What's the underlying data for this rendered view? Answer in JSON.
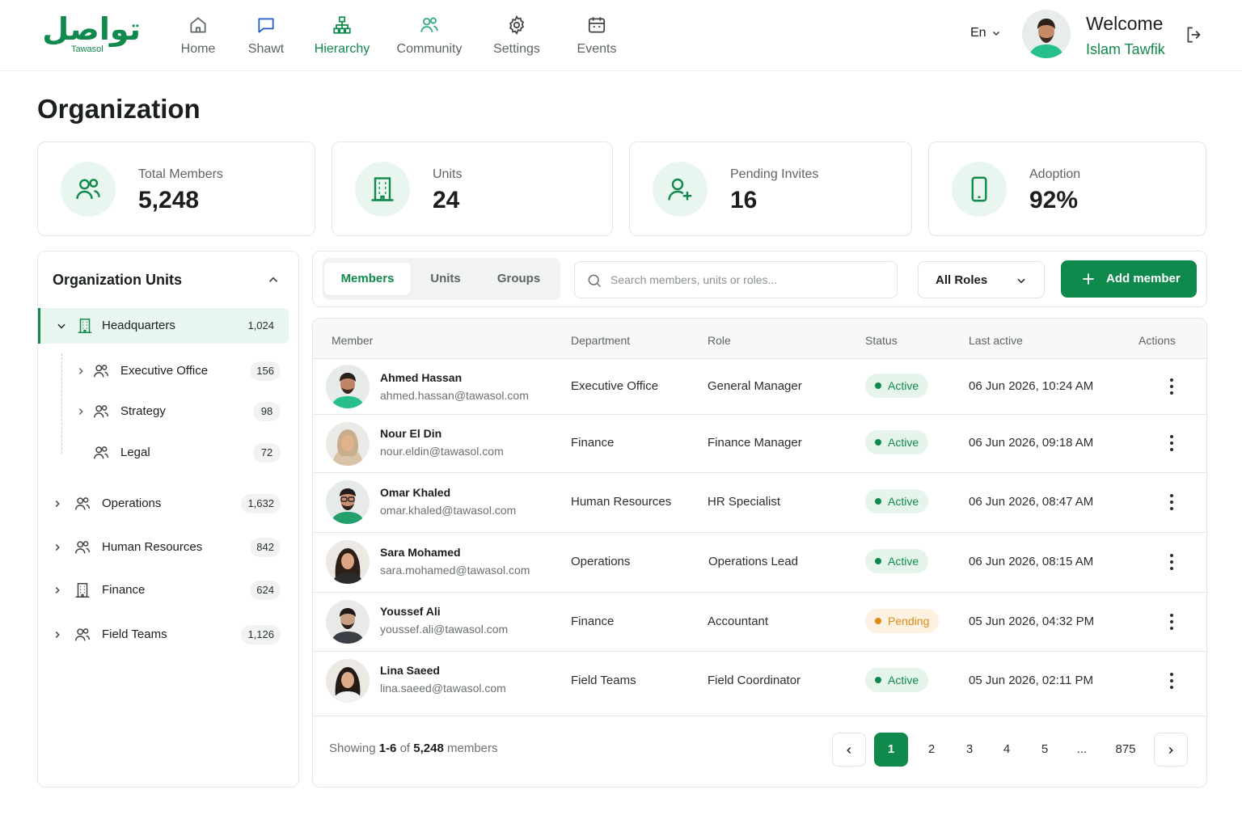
{
  "brand": {
    "arabic": "تواصل",
    "english": "Tawasol",
    "accent": "#0f8a4c"
  },
  "nav": [
    {
      "label": "Home",
      "icon": "home-icon",
      "active": false
    },
    {
      "label": "Shawt",
      "icon": "chat-icon",
      "active": false
    },
    {
      "label": "Hierarchy",
      "icon": "hierarchy-icon",
      "active": true
    },
    {
      "label": "Community",
      "icon": "community-icon",
      "active": false
    },
    {
      "label": "Settings",
      "icon": "gear-icon",
      "active": false
    },
    {
      "label": "Events",
      "icon": "calendar-icon",
      "active": false
    }
  ],
  "header": {
    "language": "En",
    "welcome": "Welcome",
    "user_name": "Islam Tawfik"
  },
  "page_title": "Organization",
  "stats": [
    {
      "label": "Total Members",
      "value": "5,248",
      "icon": "users-icon"
    },
    {
      "label": "Units",
      "value": "24",
      "icon": "building-icon"
    },
    {
      "label": "Pending Invites",
      "value": "16",
      "icon": "user-plus-icon"
    },
    {
      "label": "Adoption",
      "value": "92%",
      "icon": "mobile-icon"
    }
  ],
  "units_panel": {
    "title": "Organization Units",
    "units": [
      {
        "name": "Headquarters",
        "count": "1,024",
        "level": 0,
        "expanded": true,
        "selected": true,
        "icon": "building-icon"
      },
      {
        "name": "Executive Office",
        "count": "156",
        "level": 1,
        "expanded": false,
        "selected": false,
        "icon": "users-icon"
      },
      {
        "name": "Strategy",
        "count": "98",
        "level": 1,
        "expanded": false,
        "selected": false,
        "icon": "users-icon"
      },
      {
        "name": "Legal",
        "count": "72",
        "level": 1,
        "expanded": false,
        "selected": false,
        "icon": "users-icon"
      },
      {
        "name": "Operations",
        "count": "1,632",
        "level": 0,
        "expanded": false,
        "selected": false,
        "icon": "users-icon"
      },
      {
        "name": "Human Resources",
        "count": "842",
        "level": 0,
        "expanded": false,
        "selected": false,
        "icon": "users-icon"
      },
      {
        "name": "Finance",
        "count": "624",
        "level": 0,
        "expanded": false,
        "selected": false,
        "icon": "building-icon"
      },
      {
        "name": "Field Teams",
        "count": "1,126",
        "level": 0,
        "expanded": false,
        "selected": false,
        "icon": "users-icon"
      }
    ]
  },
  "toolbar": {
    "tabs": [
      "Members",
      "Units",
      "Groups"
    ],
    "active_tab": "Members",
    "search_placeholder": "Search members, units or roles...",
    "role_filter": "All Roles",
    "add_label": "Add member"
  },
  "table": {
    "columns": [
      "Member",
      "Department",
      "Role",
      "Status",
      "Last active",
      "Actions"
    ],
    "rows": [
      {
        "name": "Ahmed Hassan",
        "email": "ahmed.hassan@tawasol.com",
        "department": "Executive Office",
        "role": "General Manager",
        "status": "Active",
        "last_active": "06 Jun 2026, 10:24 AM"
      },
      {
        "name": "Nour El Din",
        "email": "nour.eldin@tawasol.com",
        "department": "Finance",
        "role": "Finance Manager",
        "status": "Active",
        "last_active": "06 Jun 2026, 09:18 AM"
      },
      {
        "name": "Omar Khaled",
        "email": "omar.khaled@tawasol.com",
        "department": "Human Resources",
        "role": "HR Specialist",
        "status": "Active",
        "last_active": "06 Jun 2026, 08:47 AM"
      },
      {
        "name": "Sara Mohamed",
        "email": "sara.mohamed@tawasol.com",
        "department": "Operations",
        "role": "Operations Lead",
        "status": "Active",
        "last_active": "06 Jun 2026, 08:15 AM"
      },
      {
        "name": "Youssef Ali",
        "email": "youssef.ali@tawasol.com",
        "department": "Finance",
        "role": "Accountant",
        "status": "Pending",
        "last_active": "05 Jun 2026, 04:32 PM"
      },
      {
        "name": "Lina Saeed",
        "email": "lina.saeed@tawasol.com",
        "department": "Field Teams",
        "role": "Field Coordinator",
        "status": "Active",
        "last_active": "05 Jun 2026, 02:11 PM"
      }
    ]
  },
  "footer": {
    "showing_prefix": "Showing",
    "range": "1-6",
    "of_word": "of",
    "total": "5,248",
    "suffix": "members",
    "pages": [
      "1",
      "2",
      "3",
      "4",
      "5",
      "...",
      "875"
    ],
    "current_page": "1"
  },
  "colors": {
    "active_status": "#0f8a4c",
    "pending_status": "#e08a15",
    "selected_bg": "#e9f6ef"
  }
}
